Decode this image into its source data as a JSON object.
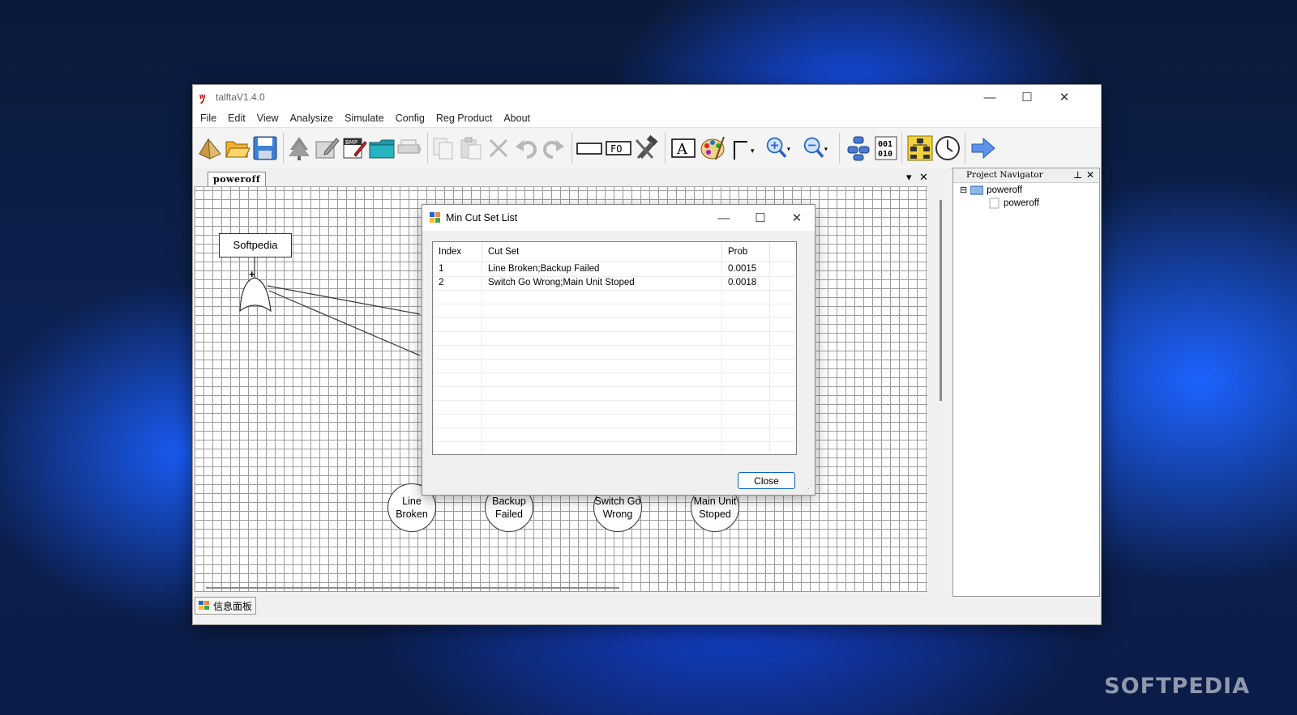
{
  "window": {
    "title": "talftaV1.4.0",
    "minimize": "—",
    "maximize": "☐",
    "close": "✕"
  },
  "menu": [
    "File",
    "Edit",
    "View",
    "Analysize",
    "Simulate",
    "Config",
    "Reg Product",
    "About"
  ],
  "toolbar_icons": [
    "new-project-icon",
    "open-folder-icon",
    "save-icon",
    "tree-icon",
    "edit-report-icon",
    "bmp-export-icon",
    "folder-tab-icon",
    "print-icon",
    "copy-icon",
    "paste-icon",
    "delete-icon",
    "undo-icon",
    "redo-icon",
    "rectangle-icon",
    "fo-box-icon",
    "tools-icon",
    "text-icon",
    "palette-icon",
    "connector-icon",
    "zoom-in-icon",
    "zoom-out-icon",
    "database-icon",
    "binary-icon",
    "hierarchy-icon",
    "clock-icon",
    "arrow-right-icon"
  ],
  "document": {
    "tab_label": "poweroff",
    "top_event": "Softpedia",
    "gate_symbol": "+",
    "basic_events": [
      "Line Broken",
      "Backup Failed",
      "Switch Go Wrong",
      "Main Unit Stoped"
    ]
  },
  "bottom_panel": {
    "label": "信息面板"
  },
  "navigator": {
    "title": "Project Navigator",
    "tree": [
      {
        "label": "poweroff",
        "expander": "⊟"
      },
      {
        "label": "poweroff"
      }
    ]
  },
  "dialog": {
    "title": "Min Cut Set List",
    "columns": [
      "Index",
      "Cut Set",
      "Prob"
    ],
    "rows": [
      {
        "index": "1",
        "cut_set": "Line Broken;Backup Failed",
        "prob": "0.0015"
      },
      {
        "index": "2",
        "cut_set": "Switch Go Wrong;Main Unit Stoped",
        "prob": "0.0018"
      }
    ],
    "close_button": "Close"
  },
  "watermark": "SOFTPEDIA",
  "colors": {
    "accent": "#0a64c8",
    "app_icon": "#c00000"
  }
}
